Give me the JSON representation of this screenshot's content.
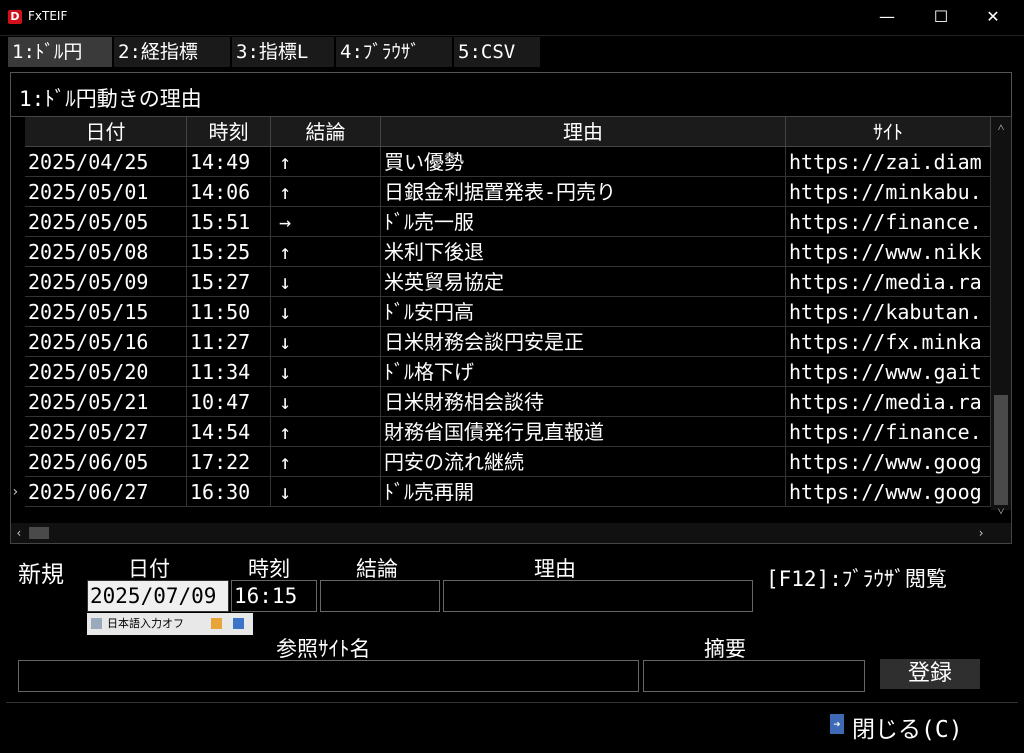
{
  "window": {
    "title": "FxTEIF",
    "icon_letter": "D",
    "min": "—",
    "max": "☐",
    "close": "✕"
  },
  "tabs": [
    {
      "label": "1:ﾄﾞﾙ円",
      "active": true
    },
    {
      "label": "2:経指標"
    },
    {
      "label": "3:指標L"
    },
    {
      "label": "4:ﾌﾞﾗｳｻﾞ"
    },
    {
      "label": "5:CSV"
    }
  ],
  "panel_title": "1:ﾄﾞﾙ円動きの理由",
  "table": {
    "columns": [
      "日付",
      "時刻",
      "結論",
      "理由",
      "ｻｲﾄ"
    ],
    "rows": [
      [
        "2025/04/25",
        "14:49",
        "↑",
        "買い優勢",
        "https://zai.diam"
      ],
      [
        "2025/05/01",
        "14:06",
        "↑",
        "日銀金利据置発表-円売り",
        "https://minkabu."
      ],
      [
        "2025/05/05",
        "15:51",
        "→",
        "ﾄﾞﾙ売一服",
        "https://finance."
      ],
      [
        "2025/05/08",
        "15:25",
        "↑",
        "米利下後退",
        "https://www.nikk"
      ],
      [
        "2025/05/09",
        "15:27",
        "↓",
        "米英貿易協定",
        "https://media.ra"
      ],
      [
        "2025/05/15",
        "11:50",
        "↓",
        "ﾄﾞﾙ安円高",
        "https://kabutan."
      ],
      [
        "2025/05/16",
        "11:27",
        "↓",
        "日米財務会談円安是正",
        "https://fx.minka"
      ],
      [
        "2025/05/20",
        "11:34",
        "↓",
        "ﾄﾞﾙ格下げ",
        "https://www.gait"
      ],
      [
        "2025/05/21",
        "10:47",
        "↓",
        "日米財務相会談待",
        "https://media.ra"
      ],
      [
        "2025/05/27",
        "14:54",
        "↑",
        "財務省国債発行見直報道",
        "https://finance."
      ],
      [
        "2025/06/05",
        "17:22",
        "↑",
        "円安の流れ継続",
        "https://www.goog"
      ],
      [
        "2025/06/27",
        "16:30",
        "↓",
        "ﾄﾞﾙ売再開",
        "https://www.goog"
      ]
    ],
    "current_row_marker": "›"
  },
  "scroll": {
    "up": "˄",
    "down": "˅",
    "left": "‹",
    "right": "›"
  },
  "form": {
    "new_label": "新規",
    "date_label": "日付",
    "time_label": "時刻",
    "conclusion_label": "結論",
    "reason_label": "理由",
    "date_value": "2025/07/09",
    "time_value": "16:15",
    "conclusion_value": "",
    "reason_value": "",
    "browser_hint": "[F12]:ﾌﾞﾗｳｻﾞ閲覧",
    "ime_status": "日本語入力オフ",
    "site_label": "参照ｻｲﾄ名",
    "summary_label": "摘要",
    "site_value": "",
    "summary_value": "",
    "register_label": "登録"
  },
  "footer": {
    "close_label": "閉じる(C)"
  }
}
